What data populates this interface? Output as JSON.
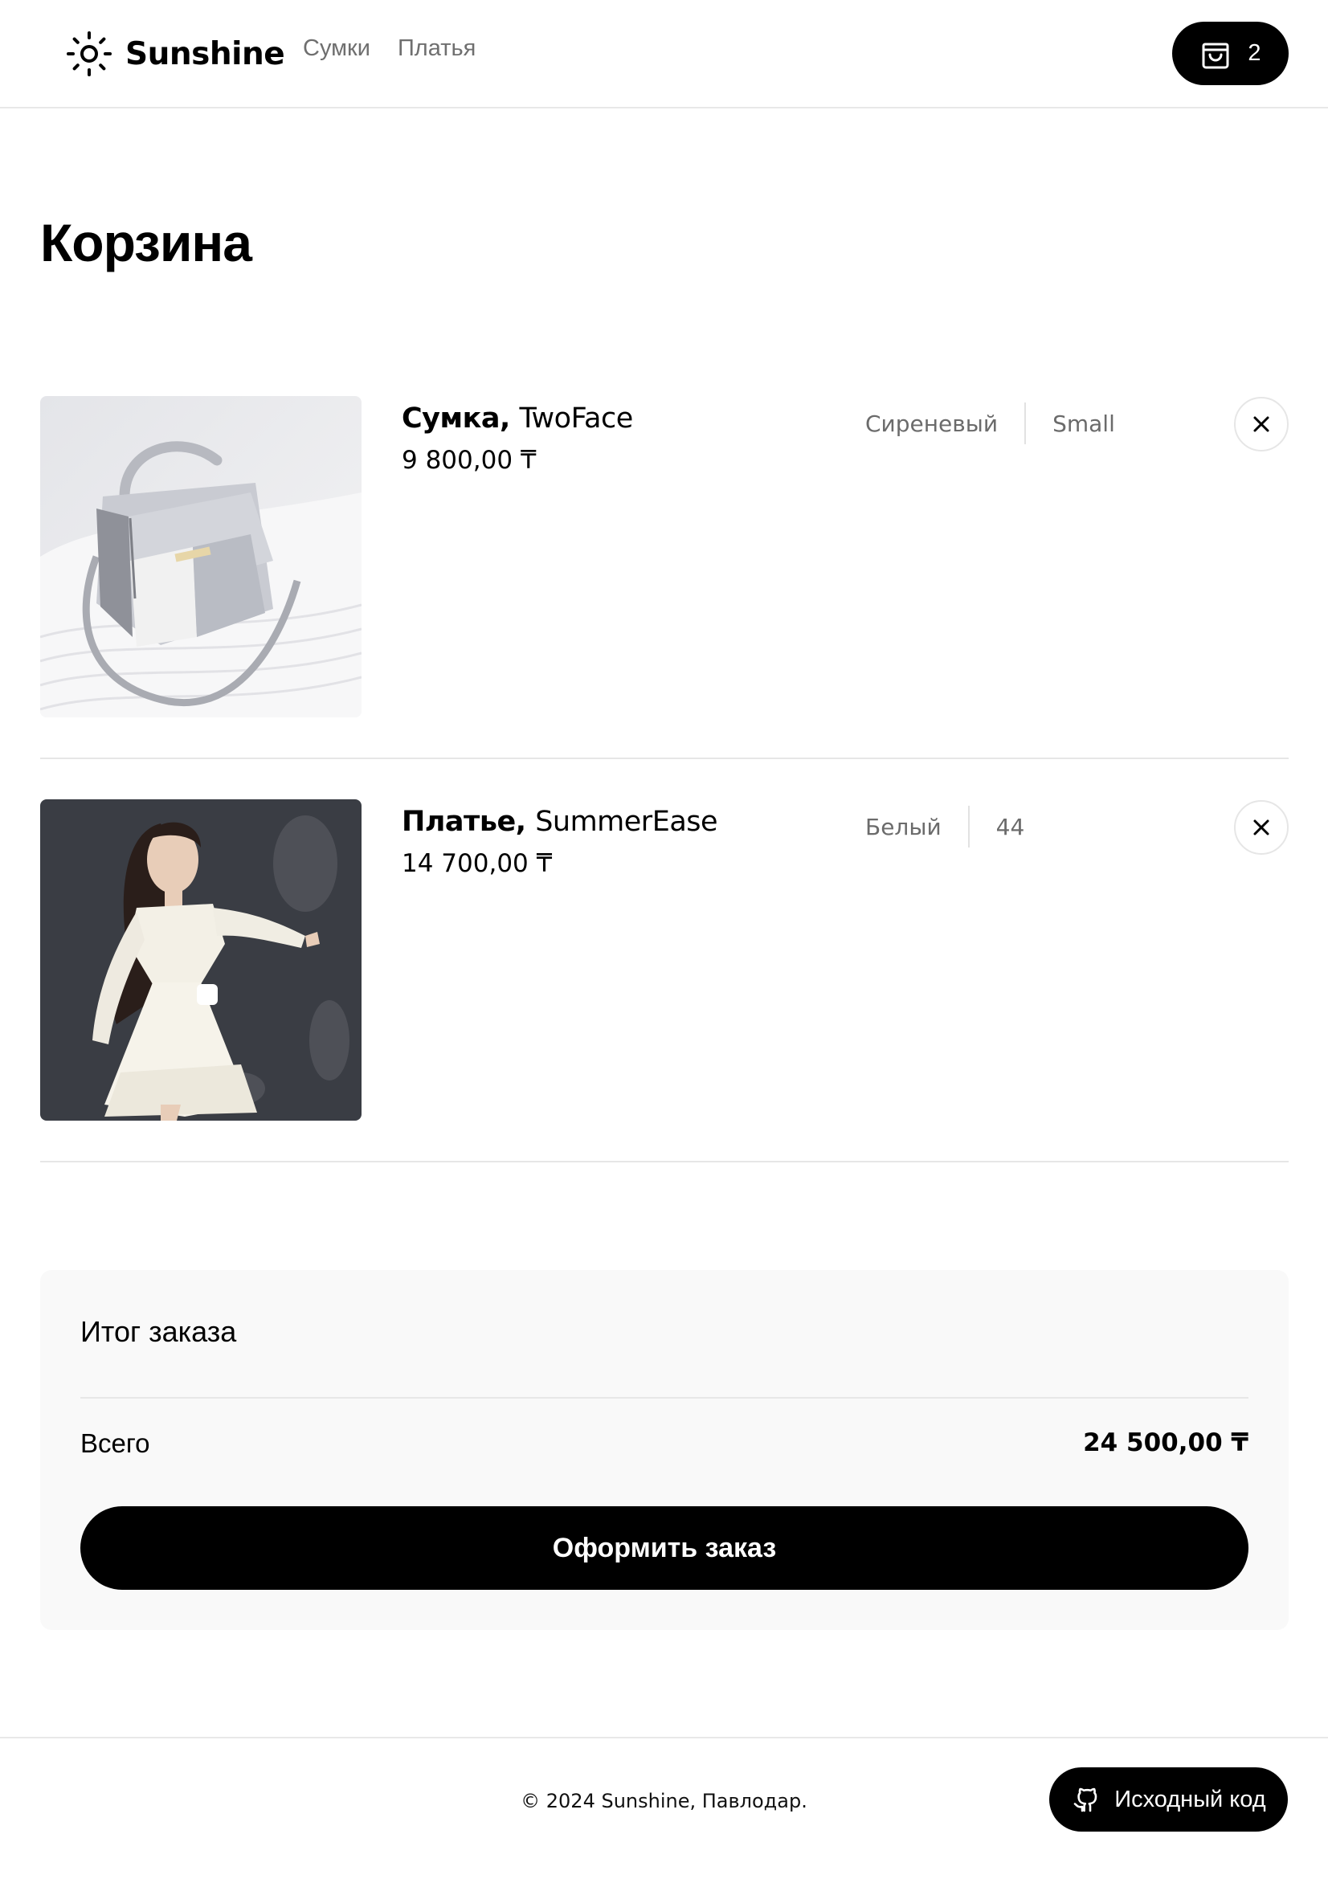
{
  "header": {
    "logo_text": "Sunshine",
    "logo_icon": "sun-icon",
    "nav": [
      {
        "label": "Сумки"
      },
      {
        "label": "Платья"
      }
    ],
    "cart": {
      "icon": "shopping-bag-icon",
      "count": "2"
    }
  },
  "page": {
    "title": "Корзина"
  },
  "cart_items": [
    {
      "name": "Сумка,",
      "brand": "TwoFace",
      "price": "9 800,00 ₸",
      "color": "Сиреневый",
      "size": "Small",
      "image": "handbag-photo"
    },
    {
      "name": "Платье,",
      "brand": "SummerEase",
      "price": "14 700,00 ₸",
      "color": "Белый",
      "size": "44",
      "image": "dress-photo"
    }
  ],
  "summary": {
    "title": "Итог заказа",
    "total_label": "Всего",
    "total_value": "24 500,00 ₸",
    "checkout_label": "Оформить заказ"
  },
  "footer": {
    "copyright": "© 2024 Sunshine, Павлодар.",
    "source_label": "Исходный код",
    "source_icon": "github-icon"
  }
}
